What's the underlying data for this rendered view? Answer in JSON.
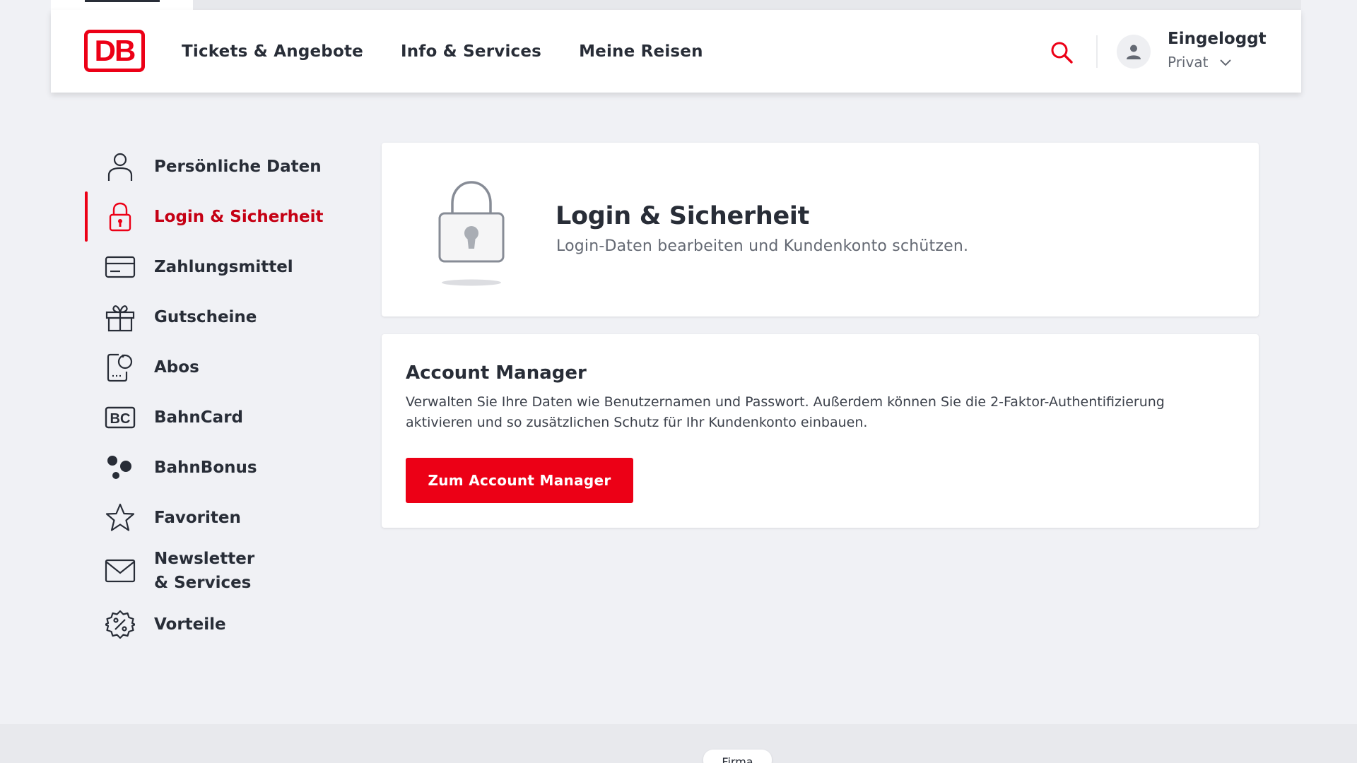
{
  "header": {
    "logo_text": "DB",
    "nav": [
      {
        "label": "Tickets & Angebote"
      },
      {
        "label": "Info & Services"
      },
      {
        "label": "Meine Reisen"
      }
    ],
    "search_icon": "search-icon",
    "user": {
      "status": "Eingeloggt",
      "account_type": "Privat"
    }
  },
  "sidebar": {
    "items": [
      {
        "label": "Persönliche Daten",
        "icon": "person-icon"
      },
      {
        "label": "Login & Sicherheit",
        "icon": "lock-icon",
        "active": true
      },
      {
        "label": "Zahlungsmittel",
        "icon": "credit-card-icon"
      },
      {
        "label": "Gutscheine",
        "icon": "gift-icon"
      },
      {
        "label": "Abos",
        "icon": "subscription-icon"
      },
      {
        "label": "BahnCard",
        "icon": "bahncard-icon"
      },
      {
        "label": "BahnBonus",
        "icon": "bahnbonus-icon"
      },
      {
        "label": "Favoriten",
        "icon": "star-icon"
      },
      {
        "label": "Newsletter & Services",
        "icon": "envelope-icon"
      },
      {
        "label": "Vorteile",
        "icon": "percent-badge-icon"
      }
    ]
  },
  "hero": {
    "title": "Login & Sicherheit",
    "subtitle": "Login-Daten bearbeiten und Kundenkonto schützen."
  },
  "account_manager": {
    "title": "Account Manager",
    "description": "Verwalten Sie Ihre Daten wie Benutzernamen und Passwort. Außerdem können Sie die 2-Faktor-Authentifizierung aktivieren und so zusätzlichen Schutz für Ihr Kundenkonto einbauen.",
    "button_label": "Zum Account Manager"
  },
  "footer": {
    "chip_label": "Firma"
  },
  "colors": {
    "brand_red": "#ec0016",
    "active_text": "#c50014",
    "text_dark": "#282d37",
    "text_muted": "#646973",
    "page_bg": "#f0f1f5"
  }
}
